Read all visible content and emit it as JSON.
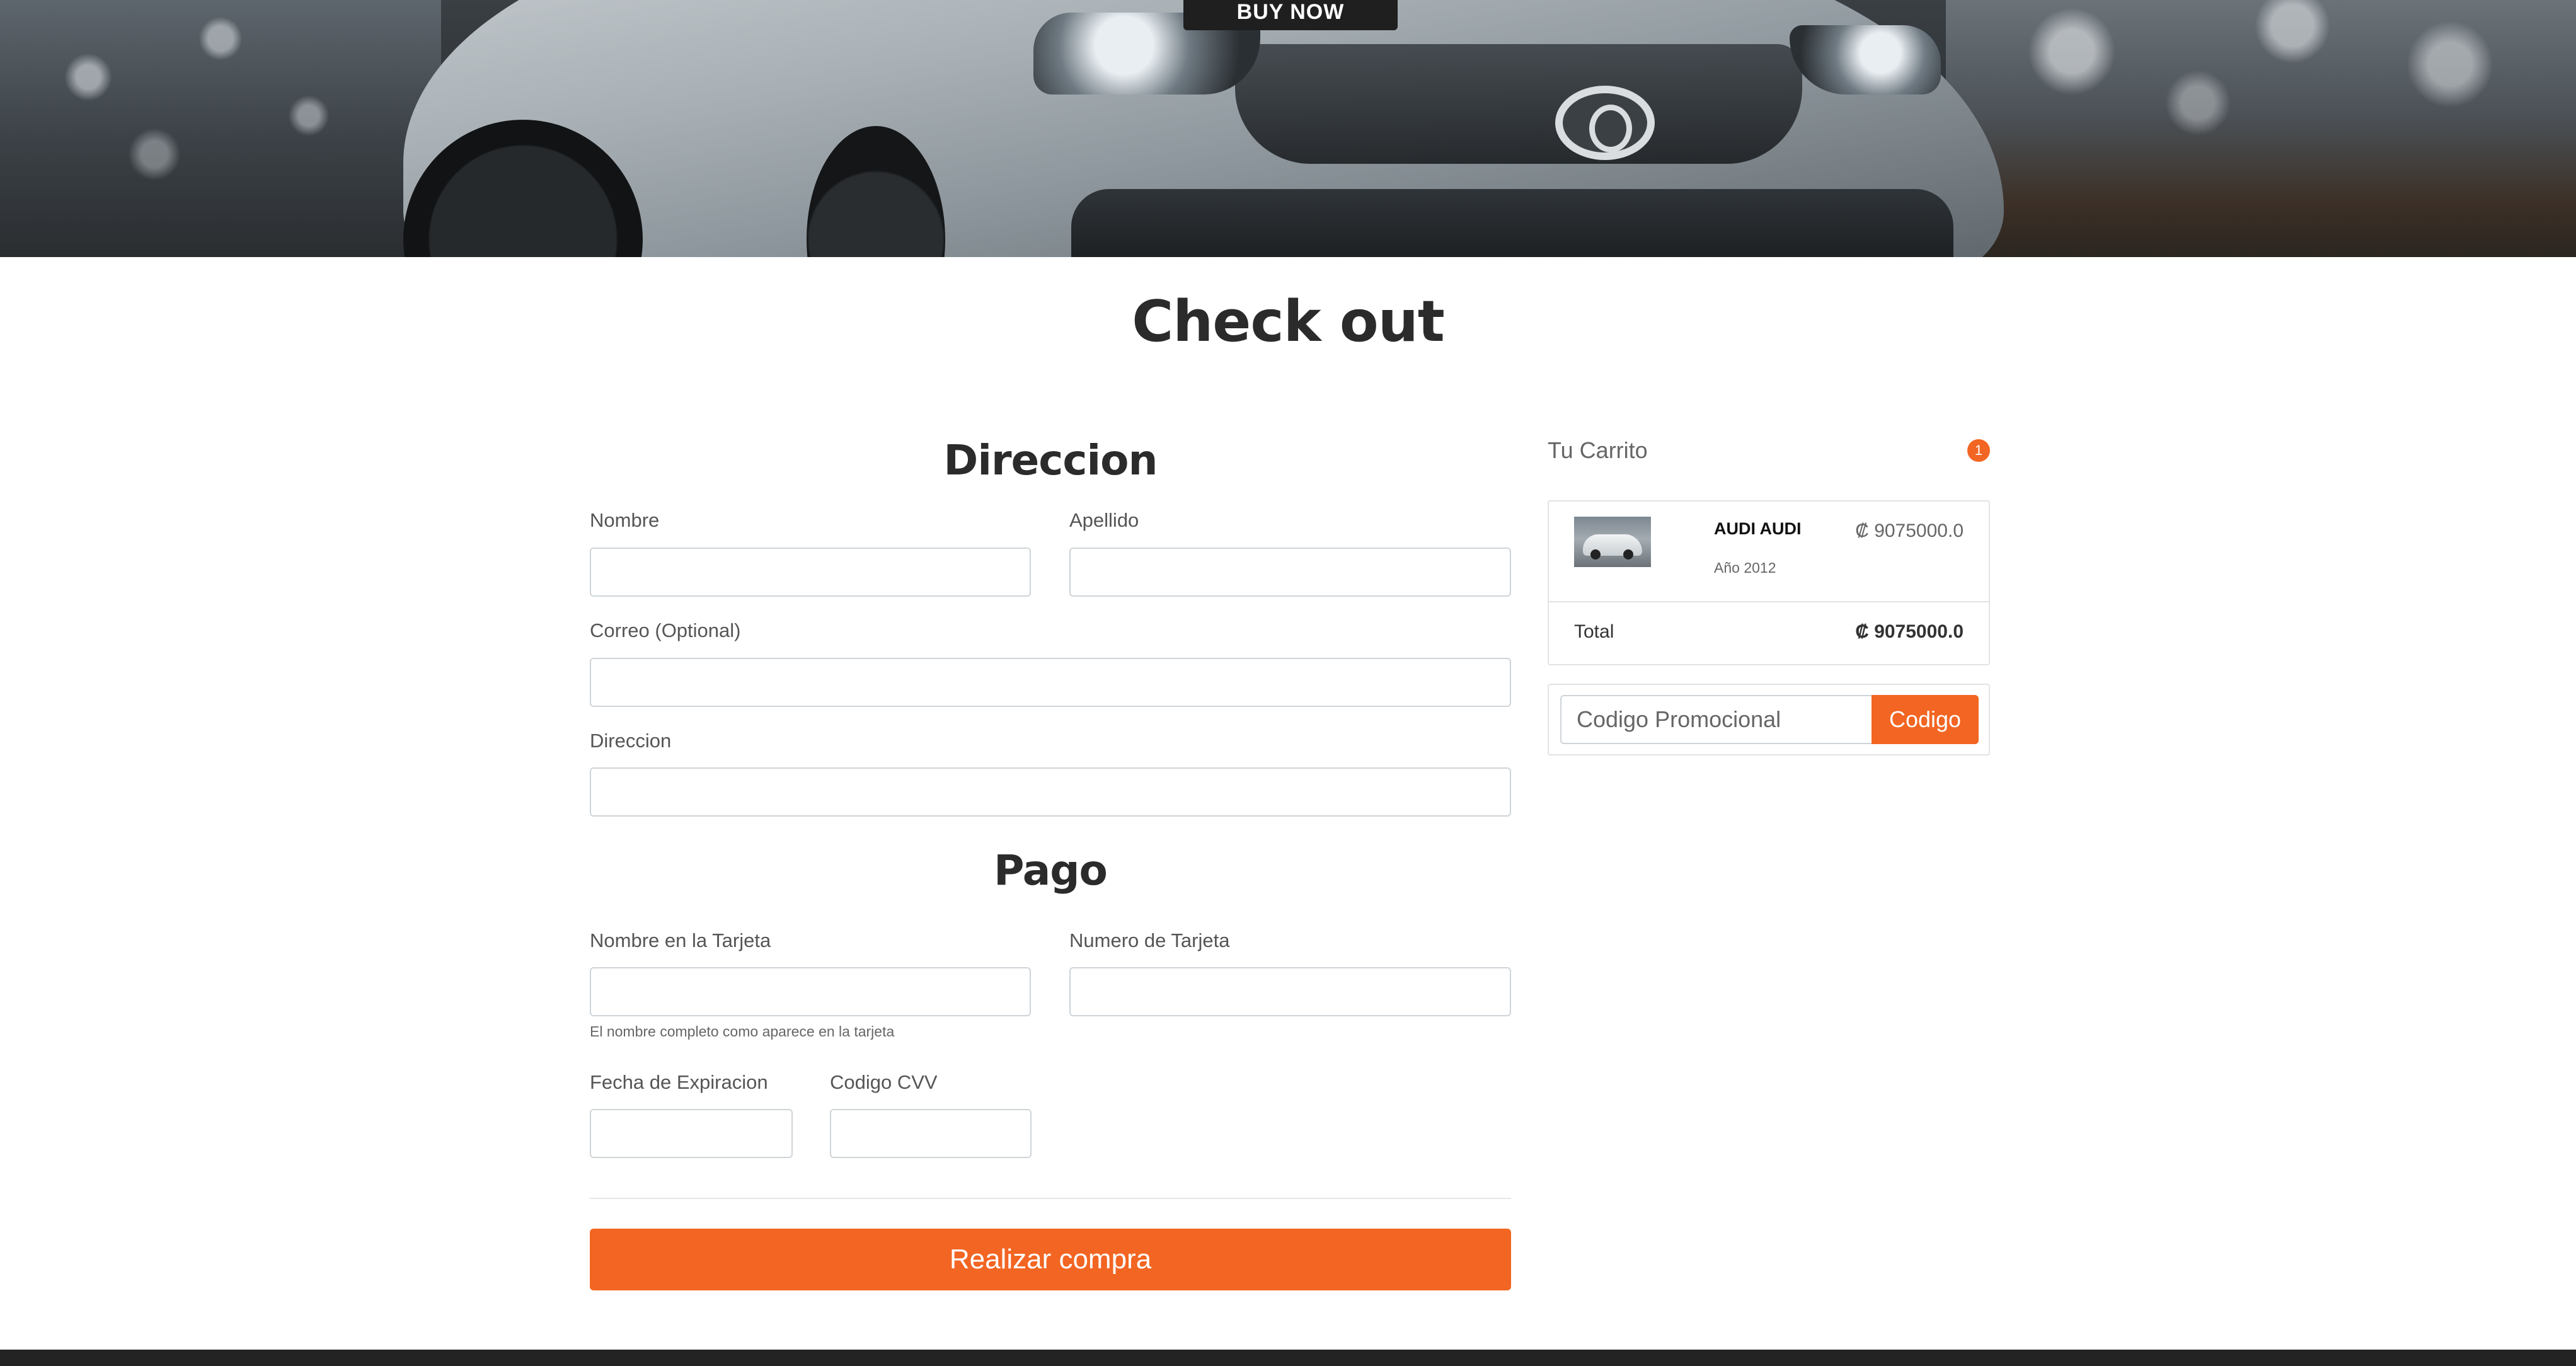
{
  "hero": {
    "buy_now_label": "BUY NOW"
  },
  "page": {
    "title": "Check out"
  },
  "address": {
    "title": "Direccion",
    "first_name_label": "Nombre",
    "first_name_value": "",
    "last_name_label": "Apellido",
    "last_name_value": "",
    "email_label": "Correo (Optional)",
    "email_value": "",
    "address_label": "Direccion",
    "address_value": ""
  },
  "payment": {
    "title": "Pago",
    "card_name_label": "Nombre en la Tarjeta",
    "card_name_value": "",
    "card_name_hint": "El nombre completo como aparece en la tarjeta",
    "card_number_label": "Numero de Tarjeta",
    "card_number_value": "",
    "expiration_label": "Fecha de Expiracion",
    "expiration_value": "",
    "cvv_label": "Codigo CVV",
    "cvv_value": "",
    "submit_label": "Realizar compra"
  },
  "cart": {
    "heading": "Tu Carrito",
    "count": "1",
    "items": [
      {
        "name": "AUDI AUDI",
        "year": "Año 2012",
        "price": "₡ 9075000.0"
      }
    ],
    "total_label": "Total",
    "total_value": "₡ 9075000.0",
    "promo_placeholder": "Codigo Promocional",
    "promo_button_label": "Codigo"
  },
  "colors": {
    "accent": "#f26522",
    "footer": "#232323"
  }
}
